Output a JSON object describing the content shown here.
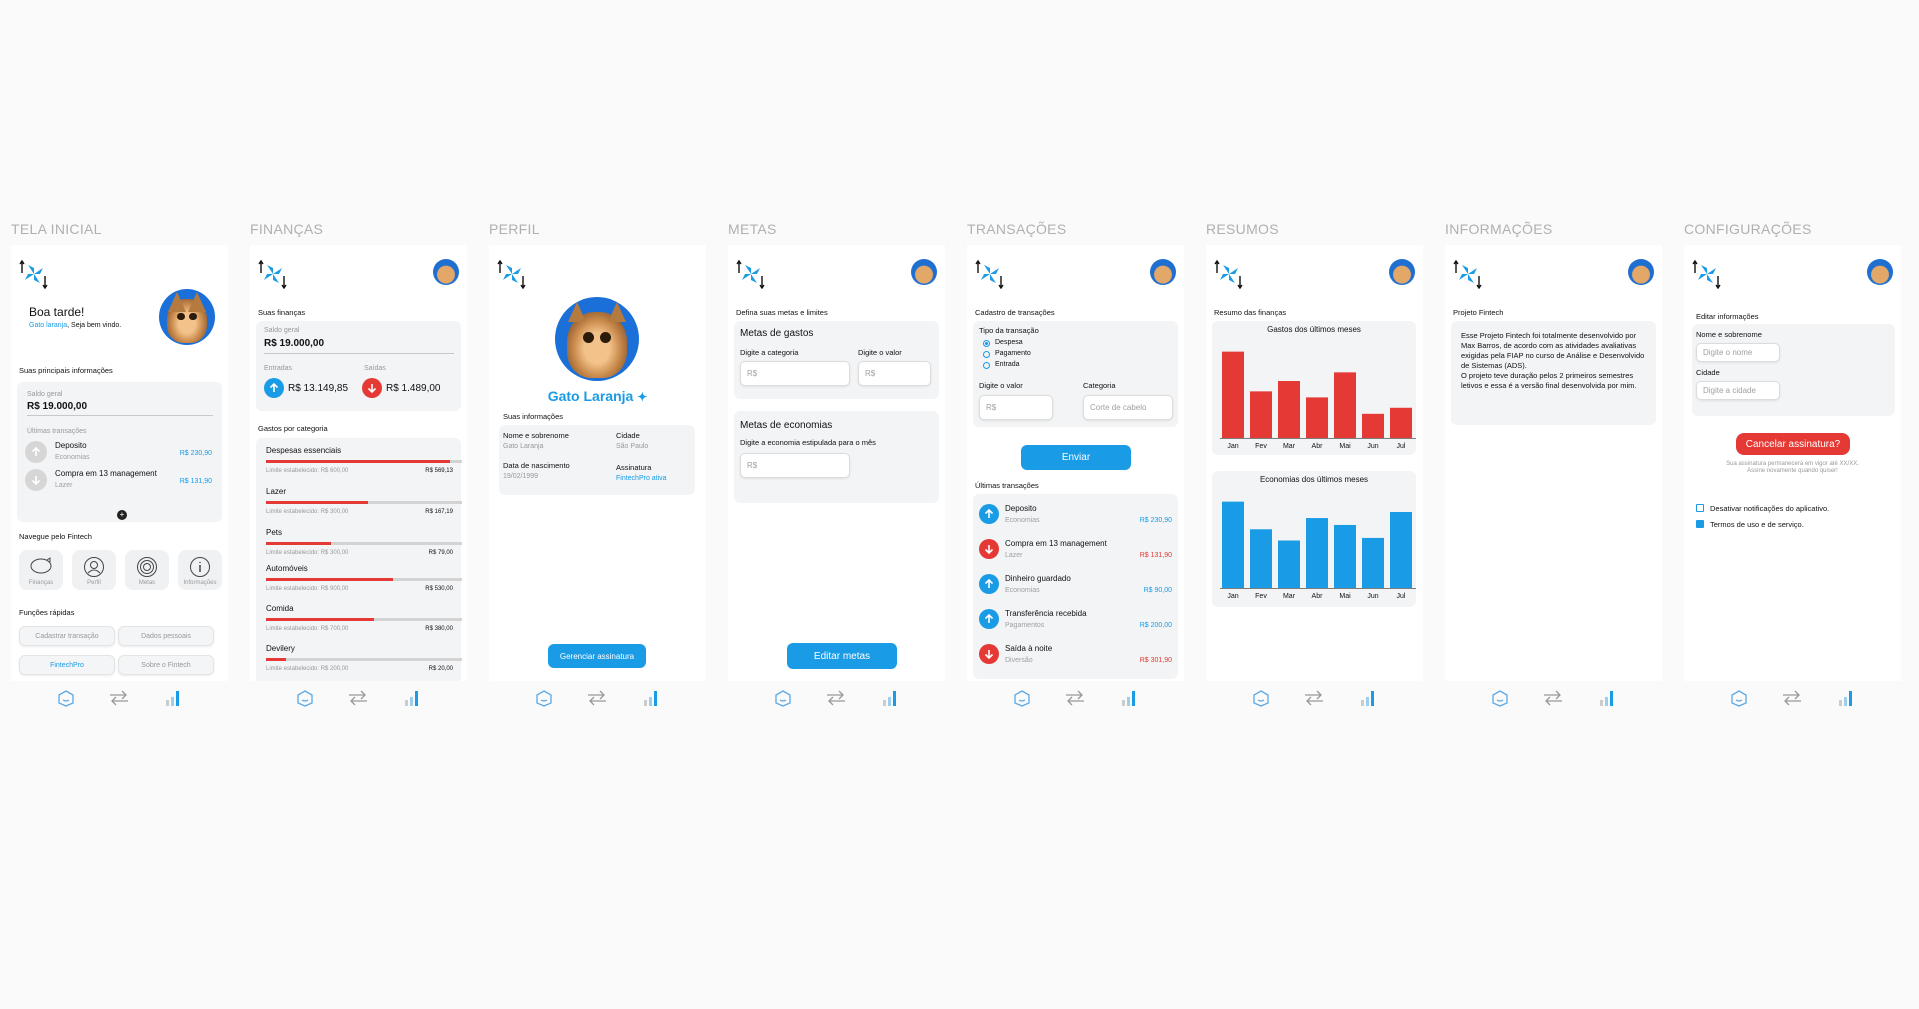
{
  "labels": [
    "TELA INICIAL",
    "FINANÇAS",
    "PERFIL",
    "METAS",
    "TRANSAÇÕES",
    "RESUMOS",
    "INFORMAÇÕES",
    "CONFIGURAÇÕES"
  ],
  "colors": {
    "accent": "#1a9be6",
    "expense": "#e53935",
    "panel": "#f2f4f5"
  },
  "home": {
    "greeting": "Boa tarde!",
    "user_link": "Gato laranja",
    "welcome_suffix": ", Seja bem vindo.",
    "main_info": "Suas principais informações",
    "balance_label": "Saldo geral",
    "balance": "R$ 19.000,00",
    "last_tx_label": "Últimas transações",
    "transactions": [
      {
        "name": "Deposito",
        "category": "Economias",
        "value": "R$ 230,90",
        "type": "in"
      },
      {
        "name": "Compra em 13 management",
        "category": "Lazer",
        "value": "R$ 131,90",
        "type": "out"
      }
    ],
    "nav_title": "Navegue pelo Fintech",
    "nav_tiles": [
      {
        "label": "Finanças",
        "icon": "piggy-bank-icon"
      },
      {
        "label": "Perfil",
        "icon": "user-icon"
      },
      {
        "label": "Metas",
        "icon": "target-icon"
      },
      {
        "label": "Informações",
        "icon": "info-icon"
      }
    ],
    "quick_title": "Funções rápidas",
    "quick": [
      "Cadastrar transação",
      "Dados pessoais",
      "FintechPro",
      "Sobre o Fintech"
    ]
  },
  "finance": {
    "summary_title": "Suas finanças",
    "balance_label": "Saldo geral",
    "balance": "R$ 19.000,00",
    "in_label": "Entradas",
    "in_value": "R$ 13.149,85",
    "out_label": "Saídas",
    "out_value": "R$ 1.489,00",
    "cat_title": "Gastos por categoria",
    "categories": [
      {
        "name": "Despesas essenciais",
        "limit": "Limite estabelecido: R$ 600,00",
        "spent": "R$ 569,13",
        "pct": 0.94
      },
      {
        "name": "Lazer",
        "limit": "Limite estabelecido: R$ 300,00",
        "spent": "R$ 167,19",
        "pct": 0.52
      },
      {
        "name": "Pets",
        "limit": "Limite estabelecido: R$ 300,00",
        "spent": "R$ 79,00",
        "pct": 0.33
      },
      {
        "name": "Automóveis",
        "limit": "Limite estabelecido: R$ 900,00",
        "spent": "R$ 530,00",
        "pct": 0.65
      },
      {
        "name": "Comida",
        "limit": "Limite estabelecido: R$ 700,00",
        "spent": "R$ 380,00",
        "pct": 0.55
      },
      {
        "name": "Devilery",
        "limit": "Limite estabelecido: R$ 200,00",
        "spent": "R$ 20,00",
        "pct": 0.1
      }
    ]
  },
  "profile": {
    "name": "Gato Laranja",
    "info_title": "Suas informações",
    "name_label": "Nome e sobrenome",
    "name_value": "Gato Laranja",
    "city_label": "Cidade",
    "city_value": "São Paulo",
    "birth_label": "Data de nascimento",
    "birth_value": "19/02/1999",
    "plan_label": "Assinatura",
    "plan_value": "FintechPro ativa",
    "manage_btn": "Gerenciar assinatura"
  },
  "goals": {
    "title": "Defina suas metas e limites",
    "spend_title": "Metas de gastos",
    "cat_label": "Digite a categoria",
    "val_label": "Digite o valor",
    "cat_ph": "R$",
    "val_ph": "R$",
    "save_title": "Metas de economias",
    "save_label": "Digite a economia estipulada para o mês",
    "save_ph": "R$",
    "edit_btn": "Editar metas"
  },
  "tx": {
    "title": "Cadastro de transações",
    "type_label": "Tipo da transação",
    "types": [
      "Despesa",
      "Pagamento",
      "Entrada"
    ],
    "value_label": "Digite o valor",
    "value_ph": "R$",
    "cat_label": "Categoria",
    "cat_ph": "Corte de cabelo",
    "send_btn": "Enviar",
    "last_title": "Últimas transações",
    "list": [
      {
        "name": "Deposito",
        "category": "Economias",
        "value": "R$ 230,90",
        "type": "in"
      },
      {
        "name": "Compra em 13 management",
        "category": "Lazer",
        "value": "R$ 131,90",
        "type": "out"
      },
      {
        "name": "Dinheiro guardado",
        "category": "Economias",
        "value": "R$ 90,00",
        "type": "in"
      },
      {
        "name": "Transferência recebida",
        "category": "Pagamentos",
        "value": "R$ 200,00",
        "type": "in"
      },
      {
        "name": "Saída à noite",
        "category": "Diversão",
        "value": "R$ 301,90",
        "type": "out"
      }
    ]
  },
  "summary": {
    "title": "Resumo das finanças"
  },
  "chart_data": [
    {
      "type": "bar",
      "title": "Gastos dos últimos meses",
      "categories": [
        "Jan",
        "Fev",
        "Mar",
        "Abr",
        "Mai",
        "Jun",
        "Jul"
      ],
      "values": [
        100,
        54,
        66,
        47,
        76,
        28,
        35
      ],
      "ylim": [
        0,
        110
      ],
      "color": "#e53935"
    },
    {
      "type": "bar",
      "title": "Economias dos últimos meses",
      "categories": [
        "Jan",
        "Fev",
        "Mar",
        "Abr",
        "Mai",
        "Jun",
        "Jul"
      ],
      "values": [
        100,
        68,
        55,
        81,
        73,
        58,
        88
      ],
      "ylim": [
        0,
        110
      ],
      "color": "#1a9be6"
    }
  ],
  "info": {
    "title": "Projeto Fintech",
    "text": "Esse Projeto Fintech foi totalmente desenvolvido por Max Barros, de acordo com as atividades avaliativas exigidas pela FIAP no curso de Análise e Desenvolvido de Sistemas (ADS).\nO projeto teve duração pelos 2 primeiros semestres letivos e essa é a versão final desenvolvida por mim."
  },
  "settings": {
    "title": "Editar informações",
    "name_label": "Nome e sobrenome",
    "name_ph": "Digite o nome",
    "city_label": "Cidade",
    "city_ph": "Digite a cidade",
    "cancel_btn": "Cancelar assinatura?",
    "cancel_note1": "Sua assinatura permanecerá em vigor até XX/XX.",
    "cancel_note2": "Assine novamente quando quiser!",
    "opt1": "Desativar notificações do aplicativo.",
    "opt2": "Termos de uso e de serviço."
  }
}
